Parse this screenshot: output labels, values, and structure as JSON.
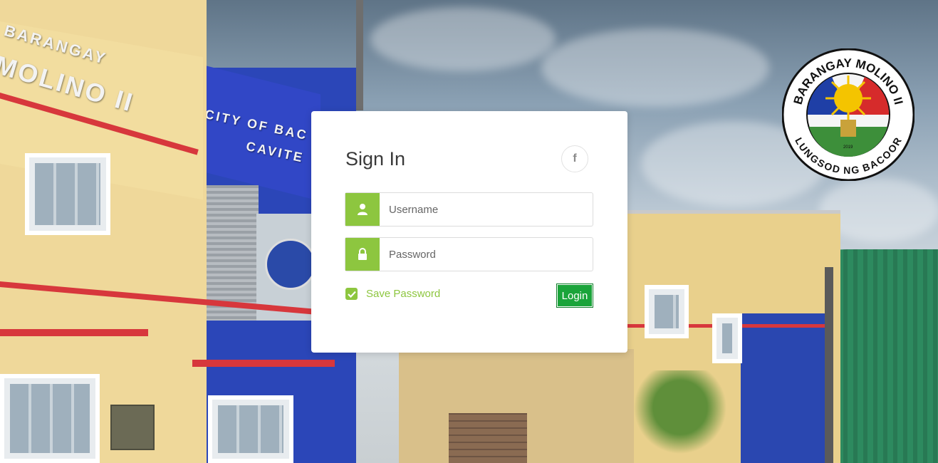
{
  "background": {
    "sign_barangay": "BARANGAY",
    "sign_molino": "MOLINO II",
    "sign_city": "CITY OF BAC",
    "sign_cavite": "CAVITE"
  },
  "seal": {
    "top_text": "BARANGAY MOLINO II",
    "bottom_text": "LUNGSOD NG BACOOR",
    "year": "2019"
  },
  "login": {
    "title": "Sign In",
    "facebook_icon": "f",
    "username_placeholder": "Username",
    "password_placeholder": "Password",
    "save_password_label": "Save Password",
    "login_label": "Login"
  },
  "colors": {
    "accent_green": "#8dc63f",
    "login_button": "#1aa43a"
  }
}
